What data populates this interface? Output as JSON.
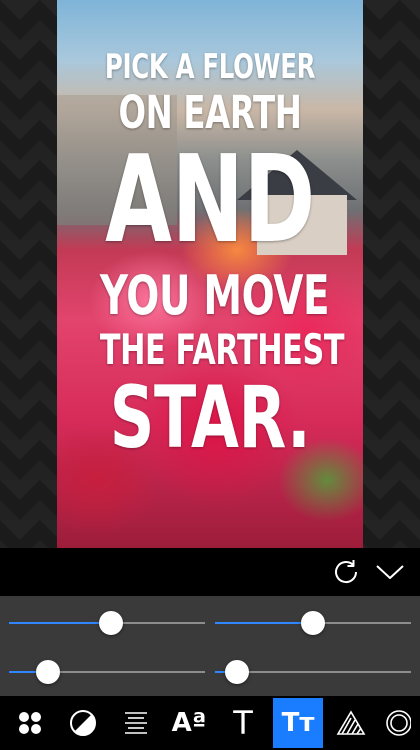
{
  "quote": {
    "line1": "PICK A FLOWER",
    "line2": "ON EARTH",
    "line3": "AND",
    "line4": "YOU MOVE",
    "line5": "THE FARTHEST",
    "line6": "STAR."
  },
  "actions": {
    "refresh_icon": "refresh-icon",
    "done_icon": "chevron-down-icon"
  },
  "sliders": [
    {
      "name": "slider-1",
      "value": 0.52
    },
    {
      "name": "slider-2",
      "value": 0.5
    },
    {
      "name": "slider-3",
      "value": 0.2
    },
    {
      "name": "slider-4",
      "value": 0.11
    }
  ],
  "toolbar": {
    "tools": [
      {
        "icon": "filters-icon"
      },
      {
        "icon": "contrast-icon"
      },
      {
        "icon": "align-icon"
      },
      {
        "icon": "font-size-icon",
        "glyph": "Aª"
      },
      {
        "icon": "text-icon",
        "glyph": "T"
      },
      {
        "icon": "text-case-icon",
        "glyph": "Tт",
        "active": true
      },
      {
        "icon": "texture-icon"
      },
      {
        "icon": "border-icon"
      }
    ]
  },
  "colors": {
    "accent": "#1a7cff",
    "slider_fill": "#2f86ff",
    "panel": "#3a3a3a"
  }
}
